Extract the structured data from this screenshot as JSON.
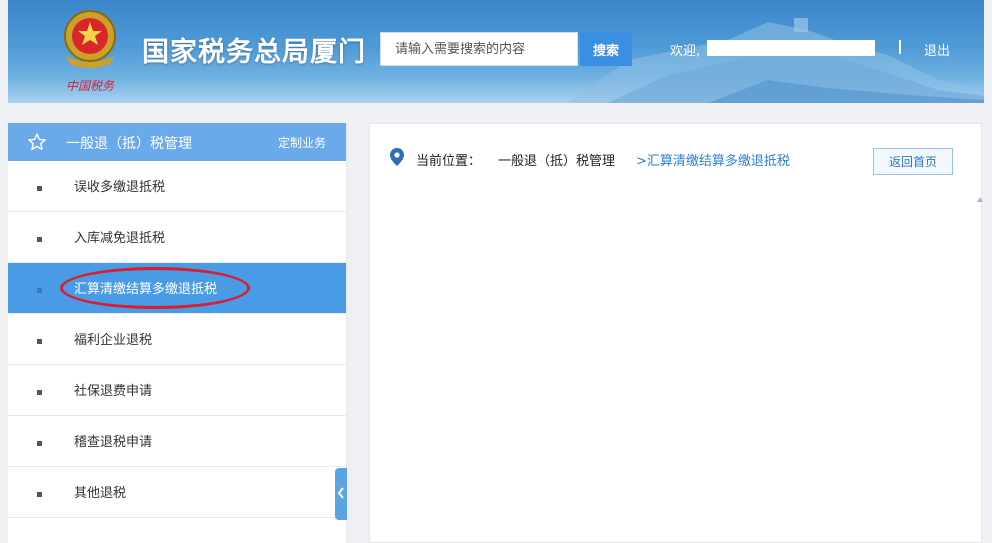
{
  "header": {
    "title": "国家税务总局厦门",
    "emblem_caption": "中国税务",
    "search": {
      "placeholder": "请输入需要搜索的内容",
      "button": "搜索"
    },
    "welcome": "欢迎,",
    "logout": "退出"
  },
  "sidebar": {
    "title": "一般退（抵）税管理",
    "custom_link": "定制业务",
    "items": [
      {
        "label": "误收多缴退抵税",
        "active": false
      },
      {
        "label": "入库减免退抵税",
        "active": false
      },
      {
        "label": "汇算清缴结算多缴退抵税",
        "active": true
      },
      {
        "label": "福利企业退税",
        "active": false
      },
      {
        "label": "社保退费申请",
        "active": false
      },
      {
        "label": "稽查退税申请",
        "active": false
      },
      {
        "label": "其他退税",
        "active": false
      }
    ]
  },
  "main": {
    "breadcrumb": {
      "label": "当前位置：",
      "root": "一般退（抵）税管理",
      "current": ">汇算清缴结算多缴退抵税"
    },
    "home_button": "返回首页"
  },
  "colors": {
    "header_blue": "#3a86c9",
    "active_item": "#4a9be6",
    "sidebar_head": "#6aa9ea",
    "highlight_ring": "#d91e2e",
    "link_blue": "#2f7fd1"
  }
}
